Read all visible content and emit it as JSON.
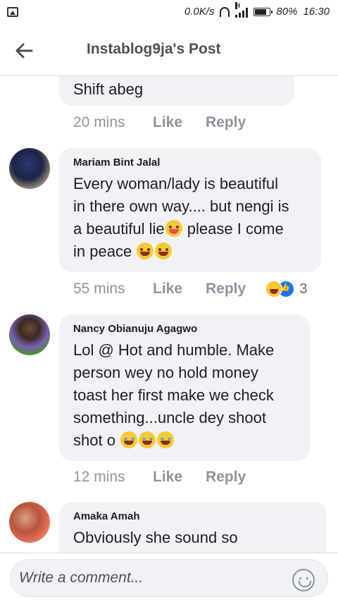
{
  "status_bar": {
    "net_speed": "0.0K/s",
    "network_label": "H",
    "battery": "80%",
    "time": "16:30"
  },
  "header": {
    "title": "Instablog9ja's Post"
  },
  "comments": [
    {
      "author": "",
      "text": "Shift abeg",
      "time": "20 mins",
      "like_label": "Like",
      "reply_label": "Reply"
    },
    {
      "author": "Mariam Bint Jalal",
      "text_lines": [
        "Every woman/lady is beautiful",
        "in there own way.... but nengi is",
        "a beautiful lie",
        "please I come",
        "in peace"
      ],
      "time": "55 mins",
      "like_label": "Like",
      "reply_label": "Reply",
      "reaction_count": "3"
    },
    {
      "author": "Nancy Obianuju Agagwo",
      "text_lines": [
        "Lol @ Hot and humble. Make",
        "person wey no hold money",
        "toast her first make we check",
        "something...uncle dey shoot",
        "shot o"
      ],
      "time": "12 mins",
      "like_label": "Like",
      "reply_label": "Reply"
    },
    {
      "author": "Amaka Amah",
      "text": "Obviously she sound so"
    }
  ],
  "composer": {
    "placeholder": "Write a comment..."
  },
  "colors": {
    "bubble": "#f0f2f5",
    "meta_text": "#8d949e",
    "title_text": "#4b4f56",
    "like_blue": "#1877f2"
  },
  "icons": [
    "image-icon",
    "headset-icon",
    "signal-icon",
    "battery-icon",
    "back-arrow-icon",
    "emoji-icon",
    "haha-reaction-icon",
    "like-reaction-icon"
  ]
}
